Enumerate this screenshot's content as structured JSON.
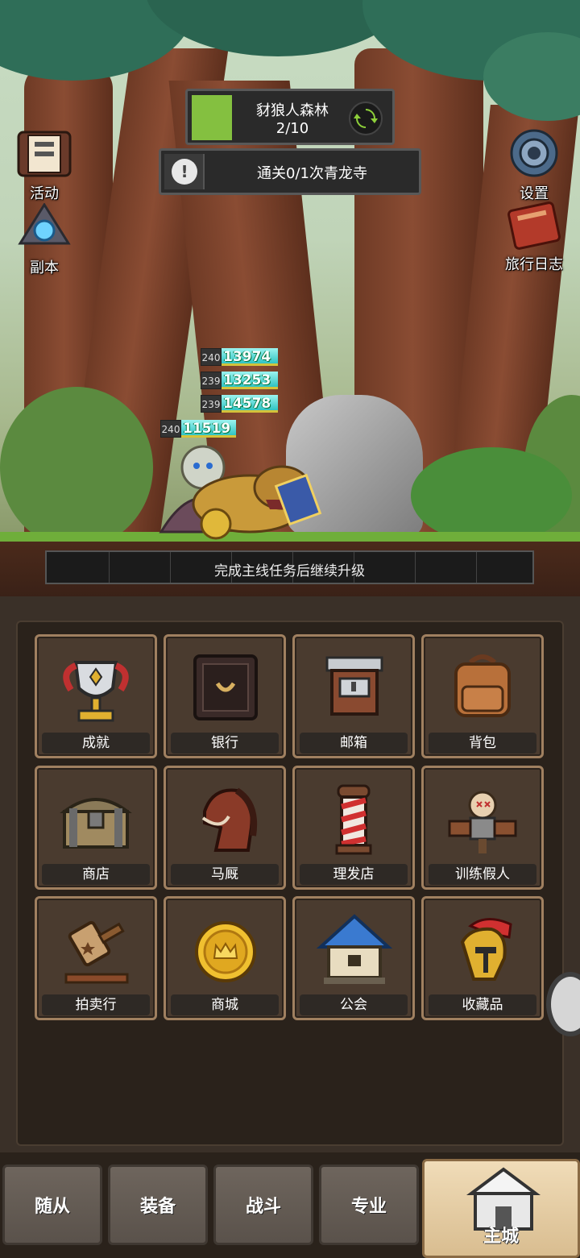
{
  "stage": {
    "name": "豺狼人森林",
    "progress": "2/10",
    "progress_fraction": 0.2
  },
  "quest": {
    "text": "通关0/1次青龙寺",
    "alert_glyph": "!"
  },
  "left_buttons": [
    {
      "id": "activity",
      "label": "活动",
      "icon": "scroll-banner-icon"
    },
    {
      "id": "dungeon",
      "label": "副本",
      "icon": "portal-stone-icon"
    }
  ],
  "right_buttons": [
    {
      "id": "settings",
      "label": "设置",
      "icon": "gear-icon"
    },
    {
      "id": "journal",
      "label": "旅行日志",
      "icon": "journal-book-icon"
    }
  ],
  "damage_numbers": [
    {
      "level": "240",
      "value": "13974"
    },
    {
      "level": "239",
      "value": "13253"
    },
    {
      "level": "239",
      "value": "14578"
    },
    {
      "level": "240",
      "value": "11519"
    }
  ],
  "xp_bar": {
    "text": "完成主线任务后继续升级"
  },
  "menu": [
    {
      "label": "成就",
      "icon": "trophy-icon"
    },
    {
      "label": "银行",
      "icon": "safe-icon"
    },
    {
      "label": "邮箱",
      "icon": "mailbox-icon"
    },
    {
      "label": "背包",
      "icon": "backpack-icon"
    },
    {
      "label": "商店",
      "icon": "chest-icon"
    },
    {
      "label": "马厩",
      "icon": "horse-icon"
    },
    {
      "label": "理发店",
      "icon": "barber-pole-icon"
    },
    {
      "label": "训练假人",
      "icon": "training-dummy-icon"
    },
    {
      "label": "拍卖行",
      "icon": "gavel-icon"
    },
    {
      "label": "商城",
      "icon": "crown-coin-icon"
    },
    {
      "label": "公会",
      "icon": "guild-house-icon"
    },
    {
      "label": "收藏品",
      "icon": "helmet-icon"
    }
  ],
  "nav": [
    {
      "label": "随从"
    },
    {
      "label": "装备"
    },
    {
      "label": "战斗"
    },
    {
      "label": "专业"
    },
    {
      "label": "主城",
      "active": true
    }
  ],
  "colors": {
    "accent_green": "#84c040",
    "tile_border": "#a08060",
    "damage_cyan": "#2fc3c3"
  }
}
